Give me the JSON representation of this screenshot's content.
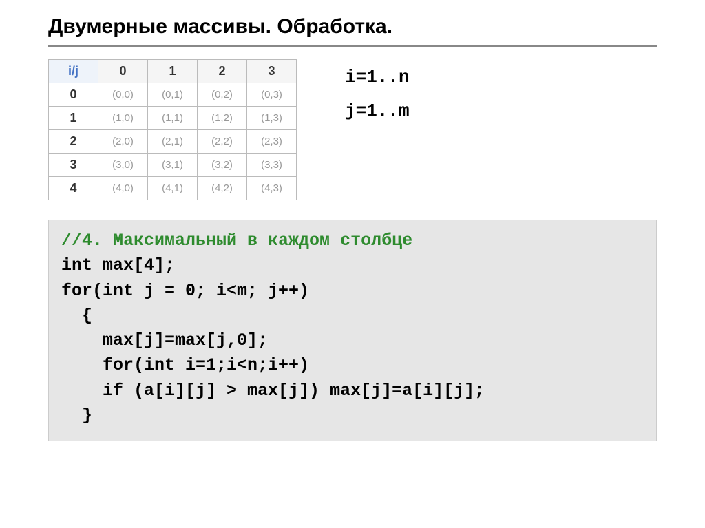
{
  "title": "Двумерные массивы. Обработка.",
  "table": {
    "corner": "i/j",
    "col_headers": [
      "0",
      "1",
      "2",
      "3"
    ],
    "row_headers": [
      "0",
      "1",
      "2",
      "3",
      "4"
    ],
    "cells": [
      [
        "(0,0)",
        "(0,1)",
        "(0,2)",
        "(0,3)"
      ],
      [
        "(1,0)",
        "(1,1)",
        "(1,2)",
        "(1,3)"
      ],
      [
        "(2,0)",
        "(2,1)",
        "(2,2)",
        "(2,3)"
      ],
      [
        "(3,0)",
        "(3,1)",
        "(3,2)",
        "(3,3)"
      ],
      [
        "(4,0)",
        "(4,1)",
        "(4,2)",
        "(4,3)"
      ]
    ]
  },
  "ranges": {
    "line1": "i=1..n",
    "line2": "j=1..m"
  },
  "code": {
    "comment": "//4. Максимальный в каждом столбце",
    "l1": "int max[4];",
    "l2": "for(int j = 0; i<m; j++)",
    "l3": "  {",
    "l4": "    max[j]=max[j,0];",
    "l5": "    for(int i=1;i<n;i++)",
    "l6": "    if (a[i][j] > max[j]) max[j]=a[i][j];",
    "l7": "  }"
  }
}
